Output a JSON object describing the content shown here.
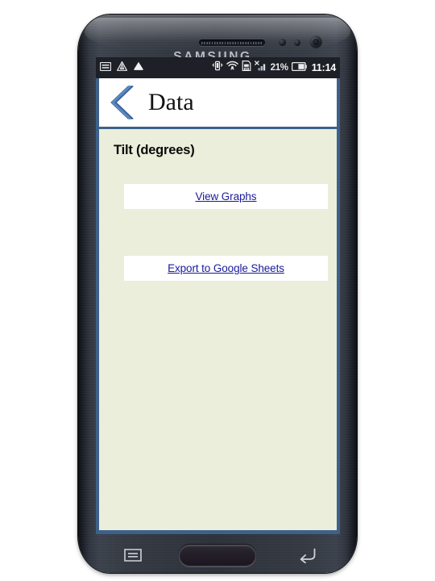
{
  "device": {
    "brand_logo": "SAMSUNG",
    "hardware_keys": {
      "menu": "menu-key",
      "home": "home-key",
      "back": "back-key"
    }
  },
  "status_bar": {
    "left_icons": [
      "keyboard-icon",
      "warning-triangle-icon",
      "cloud-upload-icon"
    ],
    "right_icons": [
      "vibrate-icon",
      "wifi-icon",
      "sd-card-icon",
      "signal-bars-icon"
    ],
    "battery_percent": "21%",
    "battery_icon": "battery-icon",
    "clock": "11:14"
  },
  "app": {
    "header": {
      "back_icon": "chevron-left-icon",
      "title": "Data"
    },
    "content": {
      "section_label": "Tilt (degrees)",
      "links": [
        {
          "label": "View Graphs"
        },
        {
          "label": "Export to Google Sheets"
        }
      ]
    }
  },
  "colors": {
    "accent_blue": "#3d6189",
    "content_background": "#eaeeda",
    "link_blue": "#1a1a9c",
    "status_bar_background": "#1d2026"
  }
}
